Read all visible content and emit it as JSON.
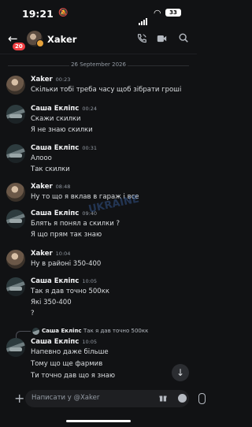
{
  "status": {
    "time": "19:21",
    "battery": "33"
  },
  "header": {
    "name": "Xaker",
    "badge": "20"
  },
  "date_separator": "26 September 2026",
  "messages": [
    {
      "author": "Xaker",
      "time": "00:23",
      "lines": [
        "Скільки тобі треба часу щоб зібрати гроші"
      ]
    },
    {
      "author": "Саша Екліпс",
      "time": "00:24",
      "lines": [
        "Скажи скилки",
        "Я не знаю скилки"
      ]
    },
    {
      "author": "Саша Екліпс",
      "time": "00:31",
      "lines": [
        "Алооо",
        "Так скилки"
      ]
    },
    {
      "author": "Xaker",
      "time": "08:48",
      "lines": [
        "Ну то що я вклав в гараж і все"
      ]
    },
    {
      "author": "Саша Екліпс",
      "time": "09:40",
      "lines": [
        "Блять я понял а скилки ?",
        "Я що прям так знаю"
      ]
    },
    {
      "author": "Xaker",
      "time": "10:04",
      "lines": [
        "Ну в районі 350-400"
      ]
    },
    {
      "author": "Саша Екліпс",
      "time": "10:05",
      "lines": [
        "Так я дав точно 500кк",
        "Які 350-400",
        "?"
      ]
    },
    {
      "author": "Саша Екліпс",
      "time": "10:05",
      "lines": [
        "Напевно даже більше",
        "Тому що ще фармив",
        "Ти точно дав що я знаю"
      ]
    }
  ],
  "reply": {
    "name": "Саша Екліпс",
    "text": "Так я дав точно 500кк"
  },
  "watermark": "UKRAINE",
  "composer": {
    "placeholder": "Написати у @Xaker"
  },
  "colors": {
    "background": "#111214",
    "mention_badge": "#f23f43",
    "away_status": "#e6a23c"
  }
}
